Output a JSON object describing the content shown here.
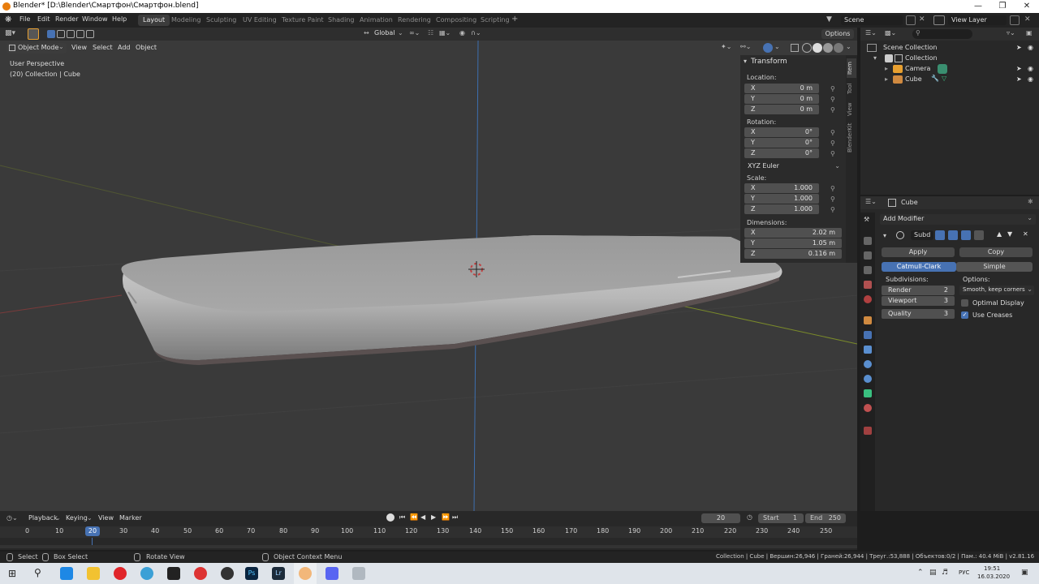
{
  "title_bar": {
    "text": "Blender* [D:\\Blender\\Смартфон\\Смартфон.blend]"
  },
  "menus": [
    "File",
    "Edit",
    "Render",
    "Window",
    "Help"
  ],
  "workspaces": [
    "Layout",
    "Modeling",
    "Sculpting",
    "UV Editing",
    "Texture Paint",
    "Shading",
    "Animation",
    "Rendering",
    "Compositing",
    "Scripting"
  ],
  "workspace_add": "+",
  "scene": {
    "name": "Scene",
    "view_layer": "View Layer"
  },
  "viewport_toolbar": {
    "orientation": "Global",
    "options": "Options"
  },
  "viewport_header": {
    "mode": "Object Mode",
    "menus": [
      "View",
      "Select",
      "Add",
      "Object"
    ]
  },
  "viewport_info": {
    "perspective": "User Perspective",
    "collection": "(20) Collection | Cube"
  },
  "transform_panel": {
    "title": "Transform",
    "location_label": "Location:",
    "location": [
      {
        "axis": "X",
        "value": "0 m"
      },
      {
        "axis": "Y",
        "value": "0 m"
      },
      {
        "axis": "Z",
        "value": "0 m"
      }
    ],
    "rotation_label": "Rotation:",
    "rotation": [
      {
        "axis": "X",
        "value": "0°"
      },
      {
        "axis": "Y",
        "value": "0°"
      },
      {
        "axis": "Z",
        "value": "0°"
      }
    ],
    "rotation_mode": "XYZ Euler",
    "scale_label": "Scale:",
    "scale": [
      {
        "axis": "X",
        "value": "1.000"
      },
      {
        "axis": "Y",
        "value": "1.000"
      },
      {
        "axis": "Z",
        "value": "1.000"
      }
    ],
    "dimensions_label": "Dimensions:",
    "dimensions": [
      {
        "axis": "X",
        "value": "2.02 m"
      },
      {
        "axis": "Y",
        "value": "1.05 m"
      },
      {
        "axis": "Z",
        "value": "0.116 m"
      }
    ]
  },
  "side_tabs": [
    "Item",
    "Tool",
    "View",
    "BlenderKit"
  ],
  "outliner": {
    "root": "Scene Collection",
    "items": [
      {
        "label": "Collection"
      },
      {
        "label": "Camera"
      },
      {
        "label": "Cube"
      }
    ]
  },
  "properties": {
    "object_name": "Cube",
    "add_modifier": "Add Modifier",
    "modifier_name": "Subd",
    "apply": "Apply",
    "copy": "Copy",
    "catmull": "Catmull-Clark",
    "simple": "Simple",
    "subdivisions_label": "Subdivisions:",
    "options_label": "Options:",
    "render_label": "Render",
    "render_value": "2",
    "viewport_label": "Viewport",
    "viewport_value": "3",
    "quality_label": "Quality",
    "quality_value": "3",
    "uv_option": "Smooth, keep corners",
    "optimal_display": "Optimal Display",
    "optimal_display_checked": false,
    "use_creases": "Use Creases",
    "use_creases_checked": true
  },
  "timeline": {
    "menus": [
      "Playback",
      "Keying",
      "View",
      "Marker"
    ],
    "current_frame": "20",
    "start_label": "Start",
    "start": "1",
    "end_label": "End",
    "end": "250",
    "ticks": [
      "0",
      "10",
      "20",
      "30",
      "40",
      "50",
      "60",
      "70",
      "80",
      "90",
      "100",
      "110",
      "120",
      "130",
      "140",
      "150",
      "160",
      "170",
      "180",
      "190",
      "200",
      "210",
      "220",
      "230",
      "240",
      "250"
    ]
  },
  "status_bar": {
    "select": "Select",
    "box_select": "Box Select",
    "rotate_view": "Rotate View",
    "context_menu": "Object Context Menu",
    "stats": "Collection | Cube | Вершин:26,946 | Граней:26,944 | Треуг.:53,888 | Объектов:0/2 | Пам.: 40.4 MiB | v2.81.16"
  },
  "taskbar": {
    "lang": "РУС",
    "time": "19:51",
    "date": "16.03.2020"
  },
  "colors": {
    "accent": "#4772b3",
    "viewport_bg": "#3a3a3a",
    "panel_bg": "#282828",
    "taskbar": "#dfe4ea"
  }
}
